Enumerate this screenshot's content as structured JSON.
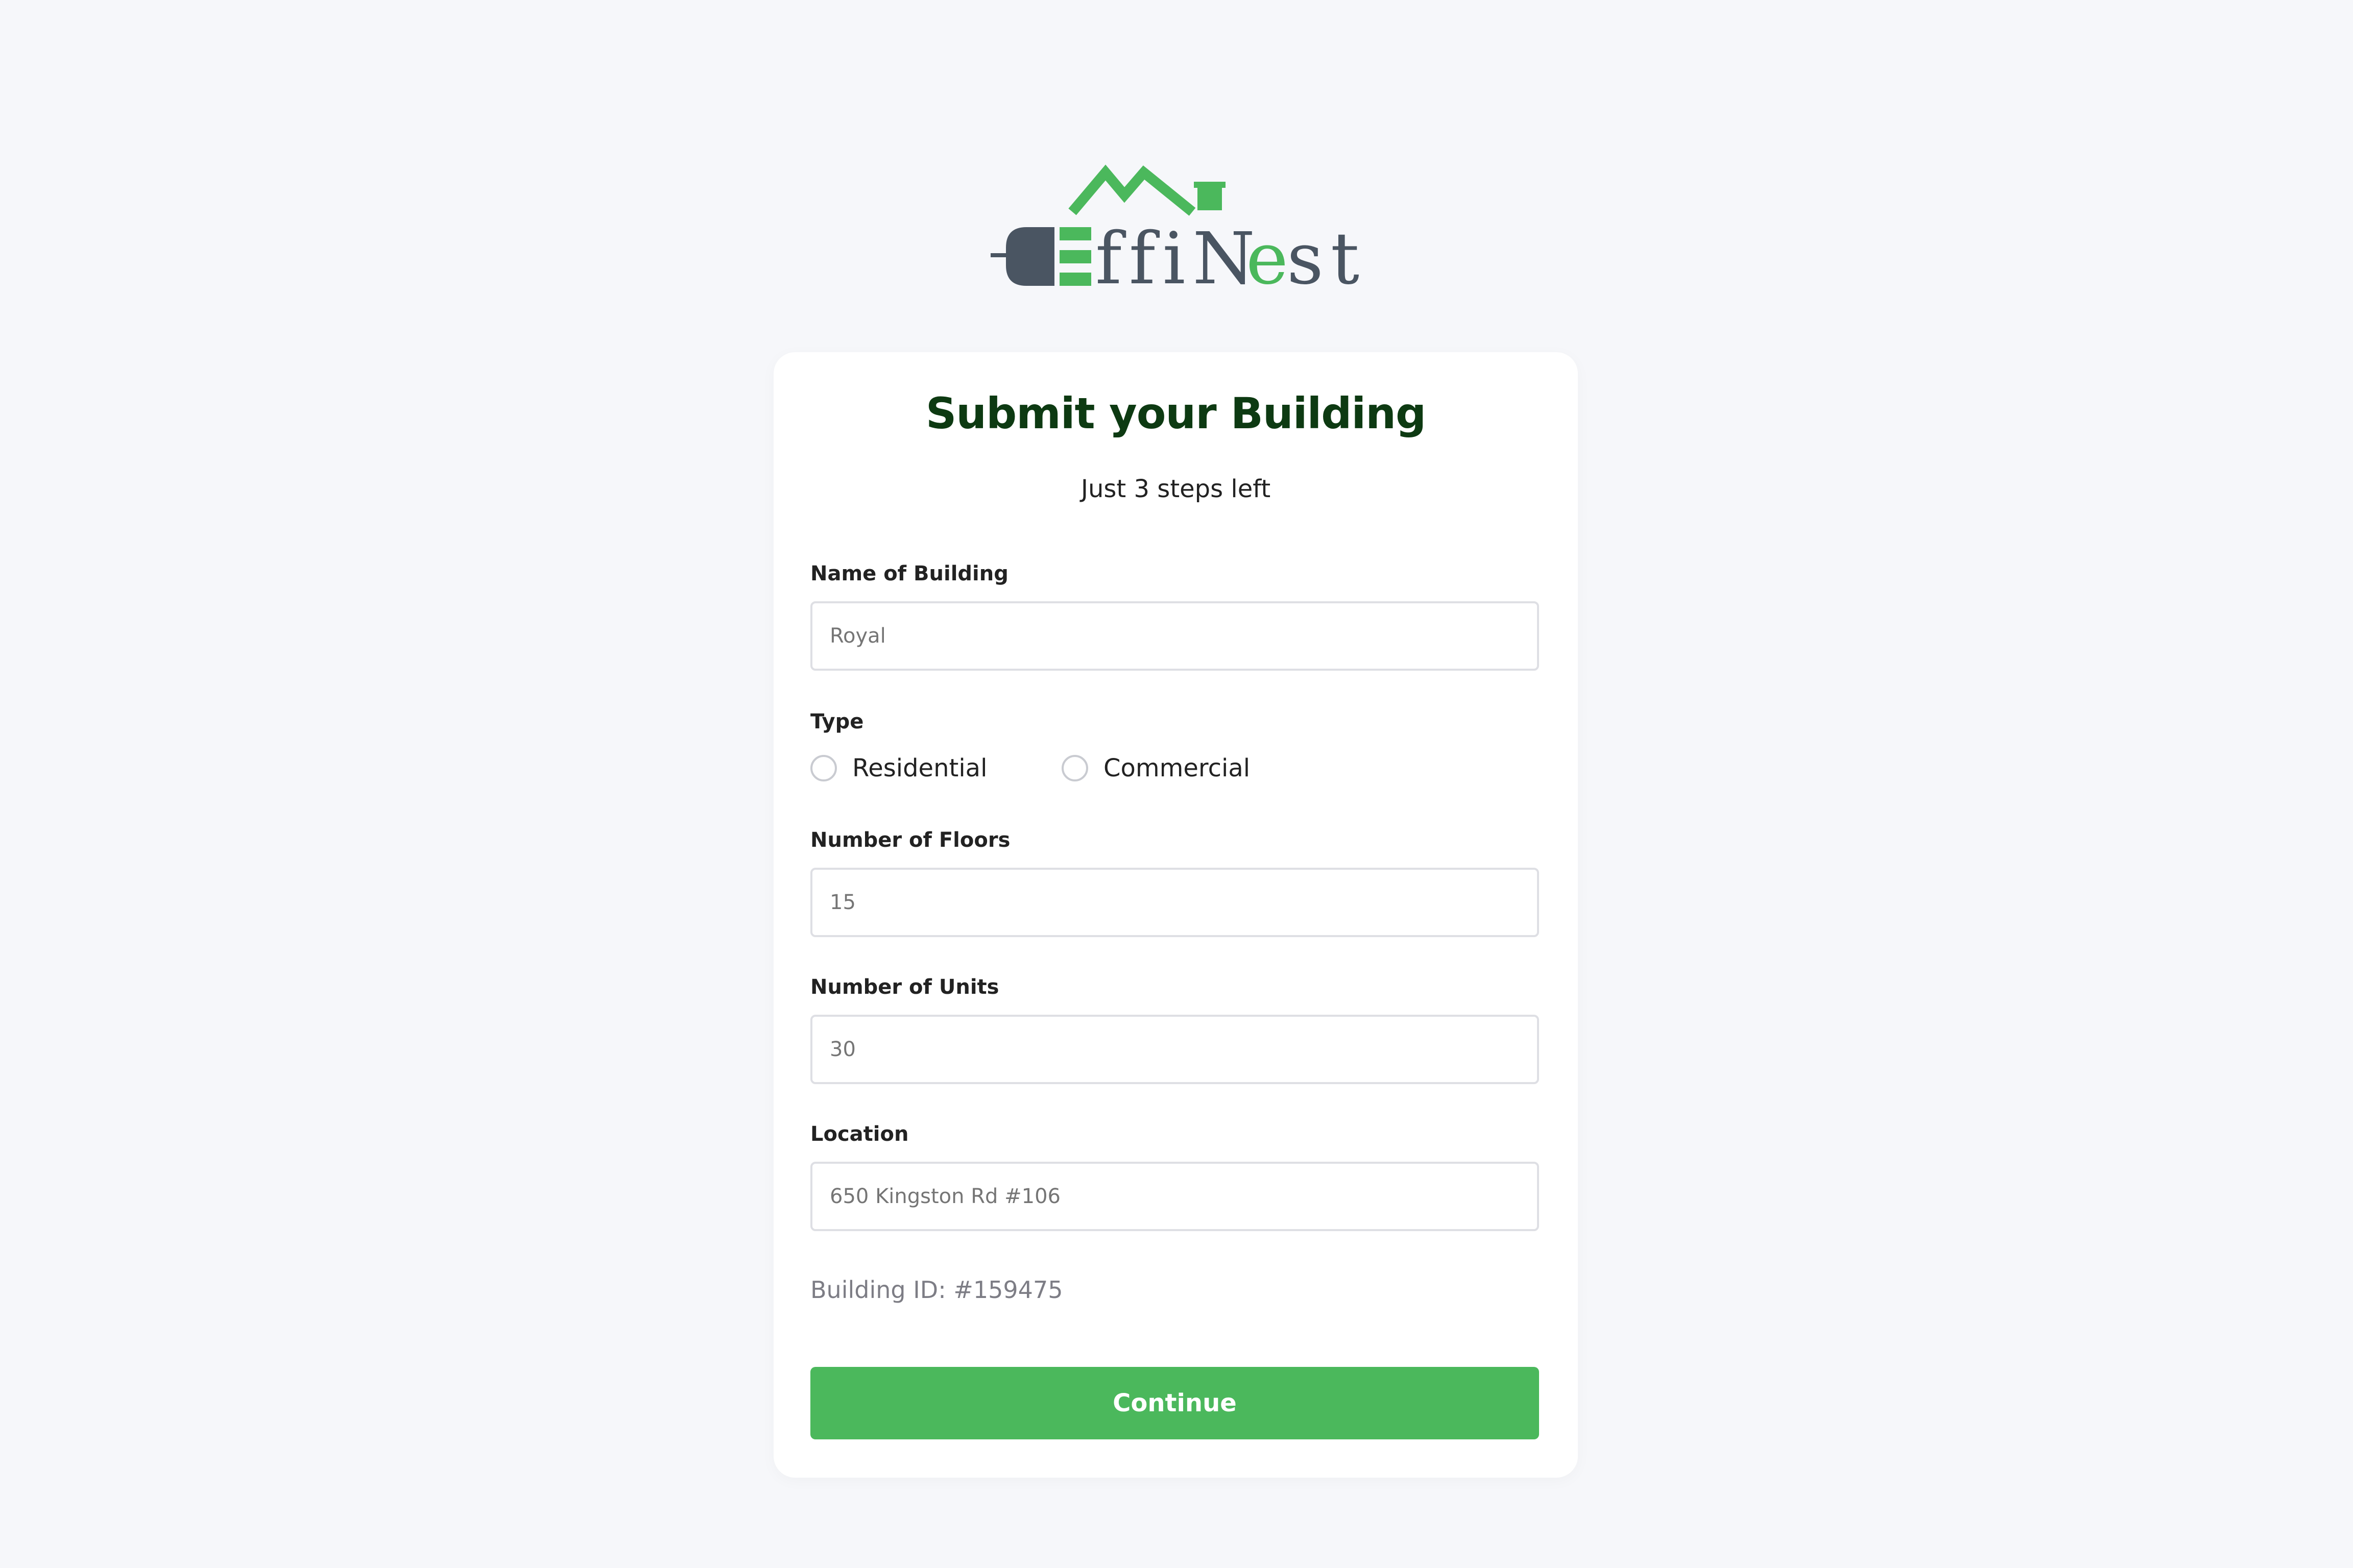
{
  "brand": {
    "logo_text": "EffiNest",
    "colors": {
      "green": "#4bb85c",
      "dark": "#4a5562",
      "title": "#0d3a12"
    }
  },
  "form": {
    "title": "Submit your Building",
    "subtitle": "Just 3 steps left",
    "fields": {
      "name": {
        "label": "Name of Building",
        "placeholder": "Royal"
      },
      "type": {
        "label": "Type",
        "options": [
          "Residential",
          "Commercial"
        ]
      },
      "floors": {
        "label": "Number of Floors",
        "placeholder": "15"
      },
      "units": {
        "label": "Number of Units",
        "placeholder": "30"
      },
      "location": {
        "label": "Location",
        "placeholder": "650 Kingston Rd #106"
      }
    },
    "building_id": "Building ID: #159475",
    "continue_label": "Continue"
  }
}
